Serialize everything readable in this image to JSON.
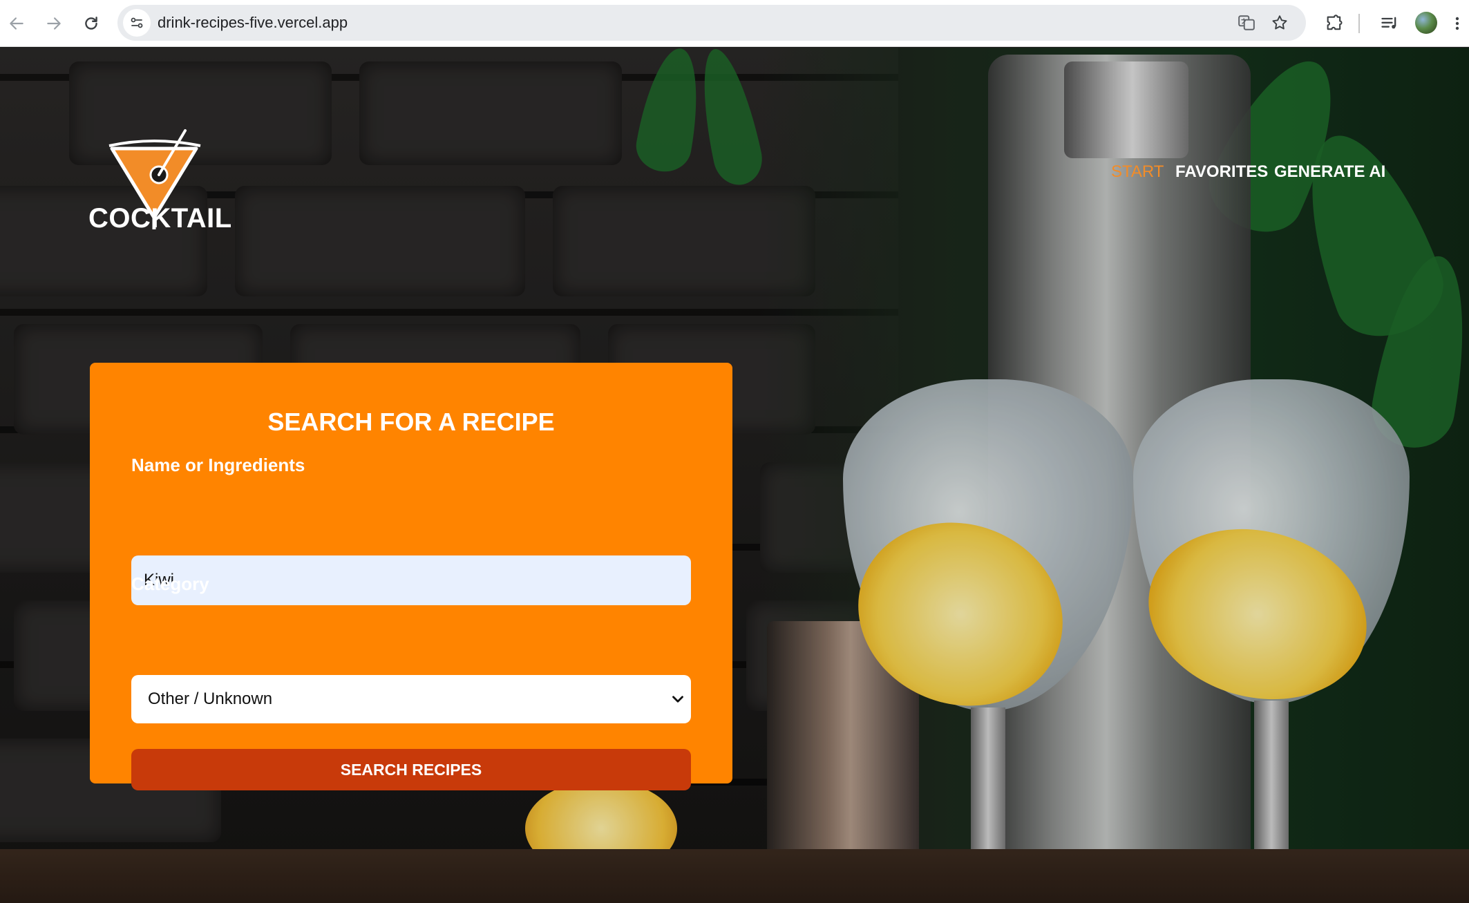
{
  "browser": {
    "url": "drink-recipes-five.vercel.app"
  },
  "header": {
    "logo_text": "COCKTAIL",
    "nav": [
      {
        "label": "START",
        "active": true
      },
      {
        "label": "FAVORITES",
        "active": false
      },
      {
        "label": "GENERATE AI",
        "active": false
      }
    ]
  },
  "search_card": {
    "title": "SEARCH FOR A RECIPE",
    "name_label": "Name or Ingredients",
    "name_value": "Kiwi",
    "category_label": "Category",
    "category_selected": "Other / Unknown",
    "submit_label": "SEARCH RECIPES"
  },
  "colors": {
    "accent": "#f28c28",
    "card": "#ff8400",
    "button": "#c83a0a",
    "input_bg": "#e8f0fe"
  },
  "icons": [
    "back-arrow-icon",
    "forward-arrow-icon",
    "reload-icon",
    "site-info-icon",
    "translate-icon",
    "bookmark-star-icon",
    "extensions-icon",
    "media-queue-icon",
    "chevron-down-icon",
    "cocktail-glass-icon"
  ]
}
